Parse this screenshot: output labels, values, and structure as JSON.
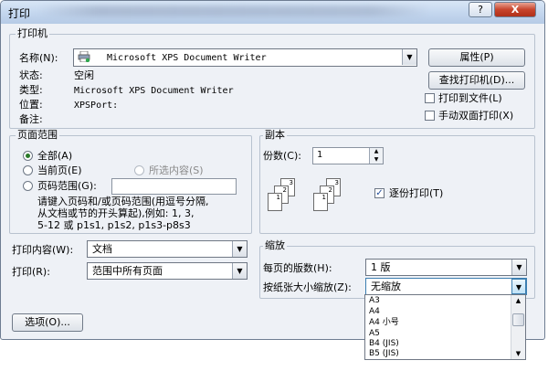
{
  "window": {
    "title": "打印",
    "help_label": "?",
    "close_label": "X"
  },
  "printer": {
    "group_label": "打印机",
    "name_label": "名称(N):",
    "name_value": "Microsoft XPS Document Writer",
    "properties_label": "属性(P)",
    "find_printer_label": "查找打印机(D)...",
    "status_label": "状态:",
    "status_value": "空闲",
    "type_label": "类型:",
    "type_value": "Microsoft XPS Document Writer",
    "where_label": "位置:",
    "where_value": "XPSPort:",
    "comment_label": "备注:",
    "print_to_file_label": "打印到文件(L)",
    "manual_duplex_label": "手动双面打印(X)"
  },
  "page_range": {
    "group_label": "页面范围",
    "all_label": "全部(A)",
    "current_label": "当前页(E)",
    "selection_label": "所选内容(S)",
    "pages_label": "页码范围(G):",
    "pages_value": "",
    "hint_lines": [
      "请键入页码和/或页码范围(用逗号分隔,",
      "从文档或节的开头算起),例如: 1, 3,",
      "5-12 或 p1s1, p1s2, p1s3-p8s3"
    ]
  },
  "copies": {
    "group_label": "副本",
    "count_label": "份数(C):",
    "count_value": "1",
    "collate_label": "逐份打印(T)",
    "collate_checked": true,
    "page_numbers": [
      "3",
      "2",
      "1",
      "3",
      "2",
      "1"
    ]
  },
  "print_what": {
    "label": "打印内容(W):",
    "value": "文档"
  },
  "print_scope": {
    "label": "打印(R):",
    "value": "范围中所有页面"
  },
  "zoom": {
    "group_label": "缩放",
    "pages_per_sheet_label": "每页的版数(H):",
    "pages_per_sheet_value": "1 版",
    "scale_label": "按纸张大小缩放(Z):",
    "scale_value": "无缩放",
    "scale_options": [
      "A3",
      "A4",
      "A4 小号",
      "A5",
      "B4 (JIS)",
      "B5 (JIS)"
    ]
  },
  "options_button_label": "选项(O)..."
}
